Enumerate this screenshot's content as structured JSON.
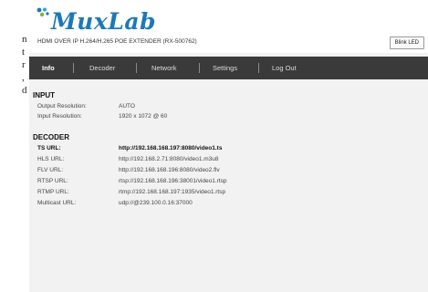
{
  "left_fragment": [
    "n",
    "t",
    "r",
    ",",
    "d"
  ],
  "brand": {
    "logo_text": "MuxLab",
    "product_name": "HDMI OVER IP H.264/H.265 POE EXTENDER (RX-500762)",
    "blink_button": "Blink LED",
    "accent_color": "#1d78b8"
  },
  "nav": {
    "items": [
      "Info",
      "Decoder",
      "Network",
      "Settings",
      "Log Out"
    ],
    "active": "Info"
  },
  "input_section": {
    "title": "INPUT",
    "rows": [
      {
        "label": "Output Resolution:",
        "value": "AUTO"
      },
      {
        "label": "Input Resolution:",
        "value": "1920 x 1072 @ 60"
      }
    ]
  },
  "decoder_section": {
    "title": "DECODER",
    "rows": [
      {
        "label": "TS URL:",
        "value": "http://192.168.168.197:8080/video1.ts"
      },
      {
        "label": "HLS URL:",
        "value": "http://192.168.2.71:8080/video1.m3u8"
      },
      {
        "label": "FLV URL:",
        "value": "http://192.168.168.196:8080/video2.flv"
      },
      {
        "label": "RTSP URL:",
        "value": "rtsp://192.168.168.196:38001/video1.rtsp"
      },
      {
        "label": "RTMP URL:",
        "value": "rtmp://192.168.168.197:1935/video1.rtsp"
      },
      {
        "label": "Multicast URL:",
        "value": "udp://@239.100.0.16:37000"
      }
    ]
  }
}
